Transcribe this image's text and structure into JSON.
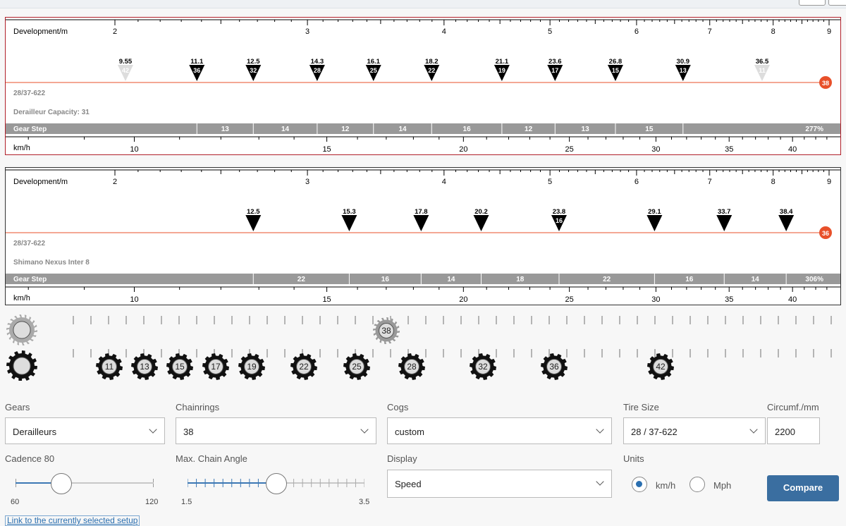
{
  "panels": [
    {
      "dev_label": "Development/m",
      "dev_ticks": [
        2,
        3,
        4,
        5,
        6,
        7,
        8,
        9
      ],
      "tire_label": "28/37-622",
      "info_label": "Derailleur Capacity: 31",
      "gear_step_label": "Gear Step",
      "chainring": "38",
      "gears": [
        {
          "dev": "9.55",
          "cog": "42",
          "faded": true
        },
        {
          "dev": "11.1",
          "cog": "36",
          "faded": false
        },
        {
          "dev": "12.5",
          "cog": "32",
          "faded": false
        },
        {
          "dev": "14.3",
          "cog": "28",
          "faded": false
        },
        {
          "dev": "16.1",
          "cog": "25",
          "faded": false
        },
        {
          "dev": "18.2",
          "cog": "22",
          "faded": false
        },
        {
          "dev": "21.1",
          "cog": "19",
          "faded": false
        },
        {
          "dev": "23.6",
          "cog": "17",
          "faded": false
        },
        {
          "dev": "26.8",
          "cog": "15",
          "faded": false
        },
        {
          "dev": "30.9",
          "cog": "13",
          "faded": false
        },
        {
          "dev": "36.5",
          "cog": "11",
          "faded": true
        }
      ],
      "steps": [
        "13",
        "14",
        "12",
        "14",
        "16",
        "12",
        "13",
        "15"
      ],
      "total": "277%",
      "speed_label": "km/h",
      "speed_ticks": [
        10,
        15,
        20,
        25,
        30,
        35,
        40
      ]
    },
    {
      "dev_label": "Development/m",
      "dev_ticks": [
        2,
        3,
        4,
        5,
        6,
        7,
        8,
        9
      ],
      "tire_label": "28/37-622",
      "info_label": "Shimano Nexus Inter 8",
      "gear_step_label": "Gear Step",
      "chainring": "36",
      "gears": [
        {
          "dev": "12.5",
          "cog": "",
          "faded": false
        },
        {
          "dev": "15.3",
          "cog": "",
          "faded": false
        },
        {
          "dev": "17.8",
          "cog": "",
          "faded": false
        },
        {
          "dev": "20.2",
          "cog": "",
          "faded": false
        },
        {
          "dev": "23.8",
          "cog": "16",
          "faded": false
        },
        {
          "dev": "29.1",
          "cog": "",
          "faded": false
        },
        {
          "dev": "33.7",
          "cog": "",
          "faded": false
        },
        {
          "dev": "38.4",
          "cog": "",
          "faded": false
        }
      ],
      "steps": [
        "22",
        "16",
        "14",
        "18",
        "22",
        "16",
        "14"
      ],
      "total": "306%",
      "speed_label": "km/h",
      "speed_ticks": [
        10,
        15,
        20,
        25,
        30,
        35,
        40
      ]
    }
  ],
  "gear_picker": {
    "chainring_selected": "38",
    "cogs": [
      "11",
      "13",
      "15",
      "17",
      "19",
      "22",
      "25",
      "28",
      "32",
      "36",
      "42"
    ]
  },
  "controls": {
    "gears_label": "Gears",
    "gears_value": "Derailleurs",
    "chainrings_label": "Chainrings",
    "chainrings_value": "38",
    "cogs_label": "Cogs",
    "cogs_value": "custom",
    "tire_label": "Tire Size",
    "tire_value": "28 / 37-622",
    "circ_label": "Circumf./mm",
    "circ_value": "2200",
    "cadence_label": "Cadence 80",
    "cadence_min": "60",
    "cadence_max": "120",
    "cadence_value": 80,
    "chain_label": "Max. Chain Angle",
    "chain_min": "1.5",
    "chain_max": "3.5",
    "chain_value": 2.5,
    "display_label": "Display",
    "display_value": "Speed",
    "units_label": "Units",
    "unit_kmh": "km/h",
    "unit_mph": "Mph",
    "unit_selected": "km/h",
    "compare_label": "Compare",
    "link_label": "Link to the currently selected setup"
  },
  "colors": {
    "accent": "#e8502a",
    "selected_border": "#b0202a",
    "bar": "#999999",
    "button": "#3a6ea0"
  }
}
